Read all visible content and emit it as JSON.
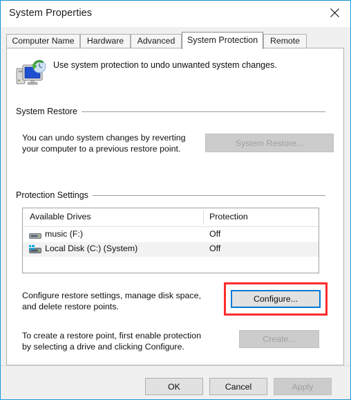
{
  "window": {
    "title": "System Properties",
    "close_icon": "close-icon",
    "accent_color": "#1a9bd7",
    "footer_bg": "#f0f0f0"
  },
  "tabs": [
    {
      "label": "Computer Name",
      "active": false
    },
    {
      "label": "Hardware",
      "active": false
    },
    {
      "label": "Advanced",
      "active": false
    },
    {
      "label": "System Protection",
      "active": true
    },
    {
      "label": "Remote",
      "active": false
    }
  ],
  "header": {
    "icon": "system-protection-icon",
    "text": "Use system protection to undo unwanted system changes."
  },
  "system_restore": {
    "group_label": "System Restore",
    "description_line1": "You can undo system changes by reverting",
    "description_line2": "your computer to a previous restore point.",
    "button_label": "System Restore...",
    "button_enabled": false
  },
  "protection_settings": {
    "group_label": "Protection Settings",
    "columns": [
      "Available Drives",
      "Protection"
    ],
    "rows": [
      {
        "icon": "drive-icon",
        "name": "music (F:)",
        "protection": "Off",
        "selected": false
      },
      {
        "icon": "system-drive-icon",
        "name": "Local Disk (C:) (System)",
        "protection": "Off",
        "selected": true
      }
    ],
    "configure": {
      "description_line1": "Configure restore settings, manage disk space,",
      "description_line2": "and delete restore points.",
      "button_label": "Configure...",
      "button_enabled": true,
      "button_focused": true,
      "highlight_color": "#ff2b2b"
    },
    "create": {
      "description_line1": "To create a restore point, first enable protection",
      "description_line2": "by selecting a drive and clicking Configure.",
      "button_label": "Create...",
      "button_enabled": false
    }
  },
  "footer": {
    "ok_label": "OK",
    "cancel_label": "Cancel",
    "apply_label": "Apply",
    "apply_enabled": false
  }
}
